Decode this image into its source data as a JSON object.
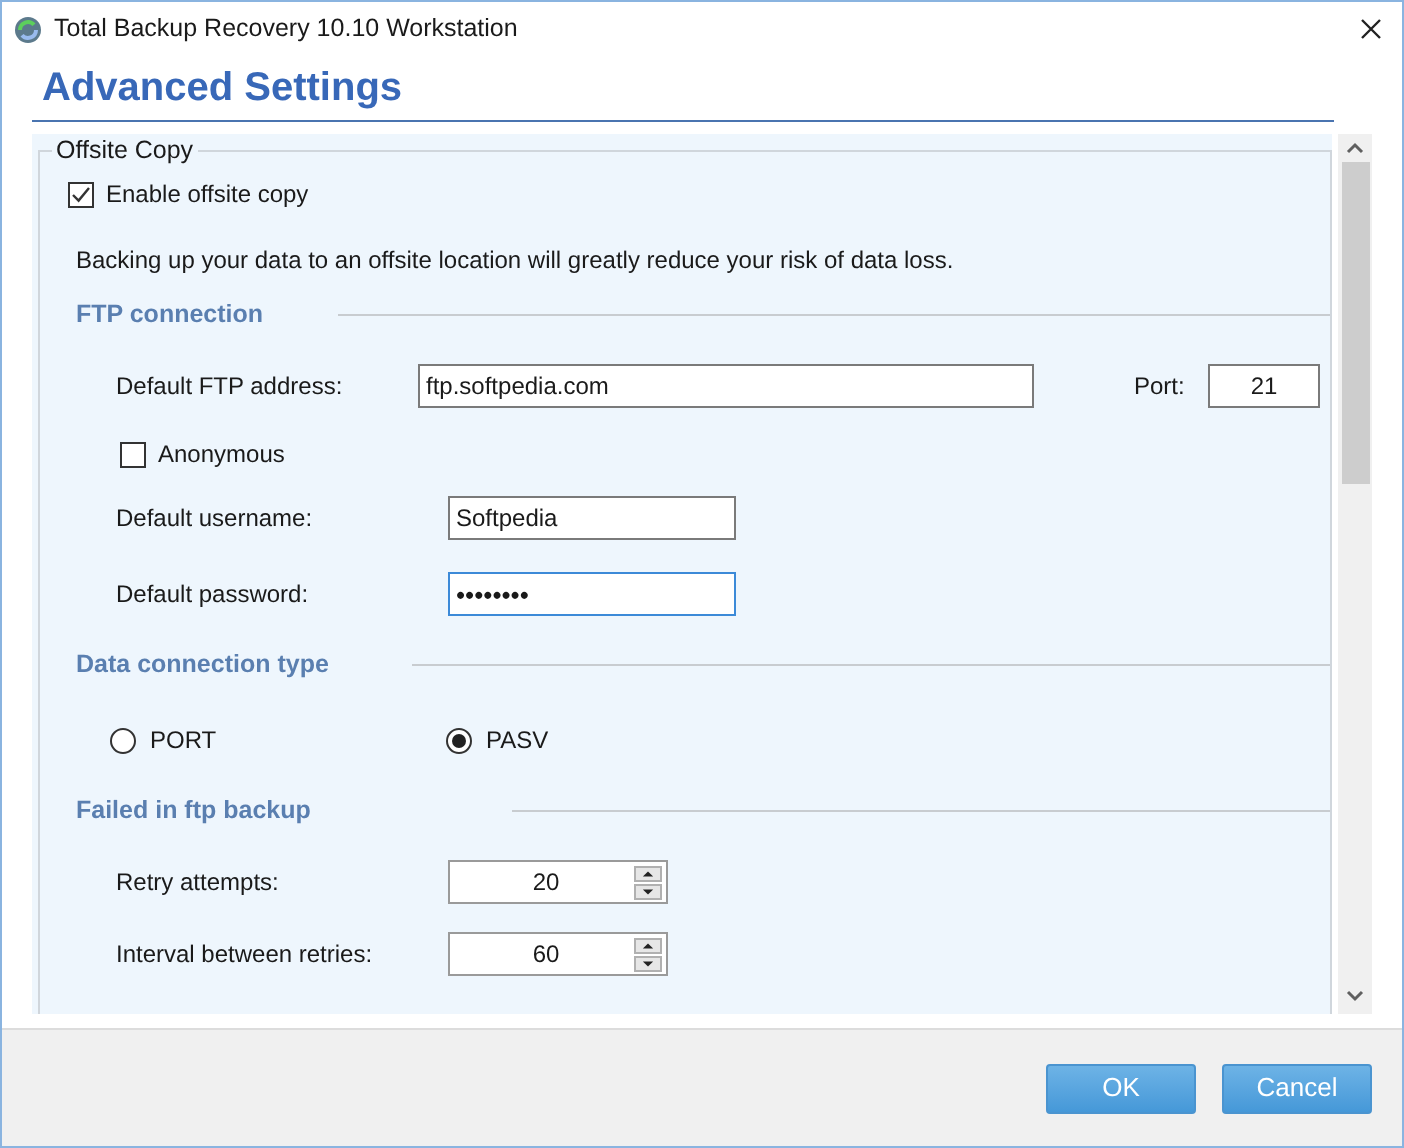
{
  "window": {
    "title": "Total Backup Recovery 10.10 Workstation"
  },
  "heading": "Advanced Settings",
  "group": {
    "title": "Offsite Copy",
    "enable": {
      "label": "Enable offsite copy",
      "checked": true
    },
    "description": "Backing up your data to an offsite location will greatly reduce your risk of data loss.",
    "sections": [
      {
        "title": "FTP connection",
        "items": [
          {
            "kind": "field",
            "label": "Default FTP address:",
            "value": "ftp.softpedia.com",
            "focused": false,
            "side_label": "Port:",
            "side_value": "21"
          },
          {
            "kind": "checkbox",
            "label": "Anonymous",
            "checked": false
          },
          {
            "kind": "field",
            "label": "Default username:",
            "value": "Softpedia",
            "focused": false
          },
          {
            "kind": "field",
            "label": "Default password:",
            "value": "••••••••",
            "focused": true
          }
        ]
      },
      {
        "title": "Data connection type",
        "items": [
          {
            "kind": "radios",
            "options": [
              {
                "label": "PORT",
                "selected": false
              },
              {
                "label": "PASV",
                "selected": true
              }
            ]
          }
        ]
      },
      {
        "title": "Failed in ftp backup",
        "items": [
          {
            "kind": "spinner",
            "label": "Retry attempts:",
            "value": "20"
          },
          {
            "kind": "spinner",
            "label": "Interval between retries:",
            "value": "60"
          }
        ]
      }
    ]
  },
  "buttons": [
    "OK",
    "Cancel"
  ]
}
